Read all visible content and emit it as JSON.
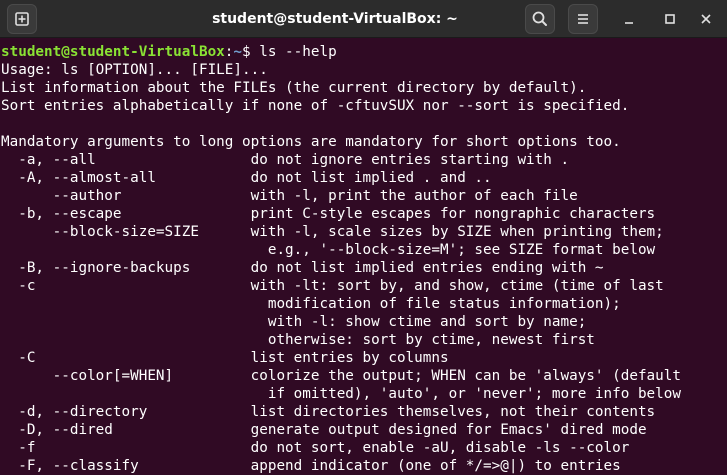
{
  "window": {
    "title": "student@student-VirtualBox: ~"
  },
  "toolbar": {
    "new_tab_icon": "new-tab-icon",
    "search_icon": "search-icon",
    "menu_icon": "hamburger-menu-icon",
    "minimize_icon": "minimize-icon",
    "maximize_icon": "maximize-icon",
    "close_icon": "close-icon"
  },
  "colors": {
    "background": "#300a24",
    "titlebar": "#2c2c2c",
    "prompt_user": "#8ae234",
    "prompt_path": "#729fcf",
    "text": "#ffffff"
  },
  "prompt": {
    "user_host": "student@student-VirtualBox",
    "colon": ":",
    "path": "~",
    "symbol": "$ ",
    "command": "ls --help"
  },
  "output_lines": [
    "Usage: ls [OPTION]... [FILE]...",
    "List information about the FILEs (the current directory by default).",
    "Sort entries alphabetically if none of -cftuvSUX nor --sort is specified.",
    "",
    "Mandatory arguments to long options are mandatory for short options too.",
    "  -a, --all                  do not ignore entries starting with .",
    "  -A, --almost-all           do not list implied . and ..",
    "      --author               with -l, print the author of each file",
    "  -b, --escape               print C-style escapes for nongraphic characters",
    "      --block-size=SIZE      with -l, scale sizes by SIZE when printing them;",
    "                               e.g., '--block-size=M'; see SIZE format below",
    "  -B, --ignore-backups       do not list implied entries ending with ~",
    "  -c                         with -lt: sort by, and show, ctime (time of last",
    "                               modification of file status information);",
    "                               with -l: show ctime and sort by name;",
    "                               otherwise: sort by ctime, newest first",
    "  -C                         list entries by columns",
    "      --color[=WHEN]         colorize the output; WHEN can be 'always' (default",
    "                               if omitted), 'auto', or 'never'; more info below",
    "  -d, --directory            list directories themselves, not their contents",
    "  -D, --dired                generate output designed for Emacs' dired mode",
    "  -f                         do not sort, enable -aU, disable -ls --color",
    "  -F, --classify             append indicator (one of */=>@|) to entries"
  ]
}
